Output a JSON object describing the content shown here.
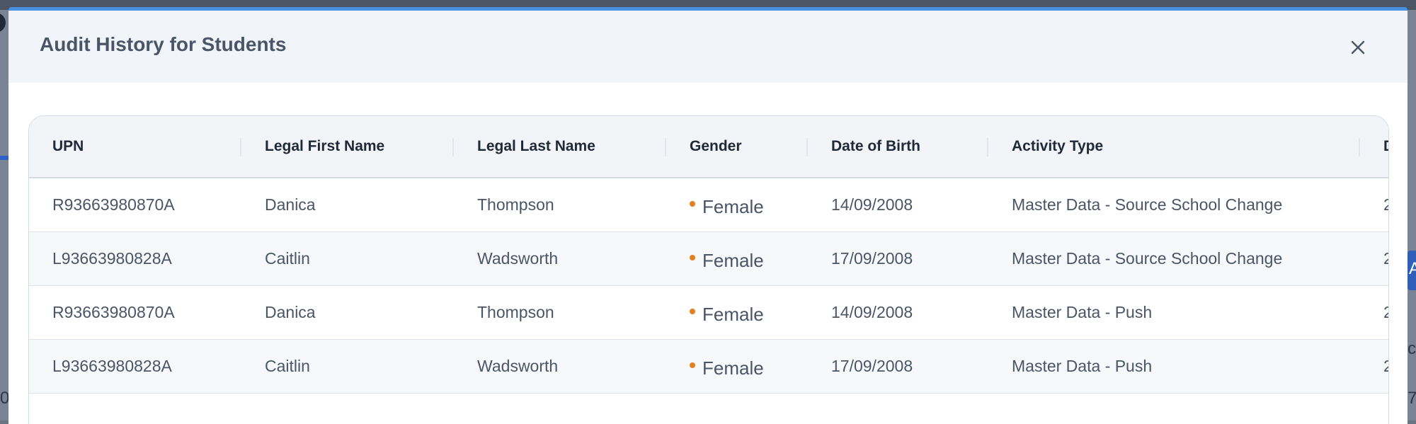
{
  "modal": {
    "title": "Audit History for Students",
    "close_icon": "close-icon",
    "accent_color": "#4a90e2"
  },
  "table": {
    "columns": [
      "UPN",
      "Legal First Name",
      "Legal Last Name",
      "Gender",
      "Date of Birth",
      "Activity Type",
      "D"
    ],
    "rows": [
      {
        "upn": "R93663980870A",
        "first": "Danica",
        "last": "Thompson",
        "gender": "Female",
        "dob": "14/09/2008",
        "activity": "Master Data - Source School Change",
        "extra": "2"
      },
      {
        "upn": "L93663980828A",
        "first": "Caitlin",
        "last": "Wadsworth",
        "gender": "Female",
        "dob": "17/09/2008",
        "activity": "Master Data - Source School Change",
        "extra": "2"
      },
      {
        "upn": "R93663980870A",
        "first": "Danica",
        "last": "Thompson",
        "gender": "Female",
        "dob": "14/09/2008",
        "activity": "Master Data - Push",
        "extra": "2"
      },
      {
        "upn": "L93663980828A",
        "first": "Caitlin",
        "last": "Wadsworth",
        "gender": "Female",
        "dob": "17/09/2008",
        "activity": "Master Data - Push",
        "extra": "2"
      }
    ],
    "gender_dot_color": "#e67e22"
  },
  "background": {
    "left_edge_text": "0",
    "right_edge_text_1": "ce",
    "right_edge_text_2": "7",
    "right_button_text": "A"
  }
}
